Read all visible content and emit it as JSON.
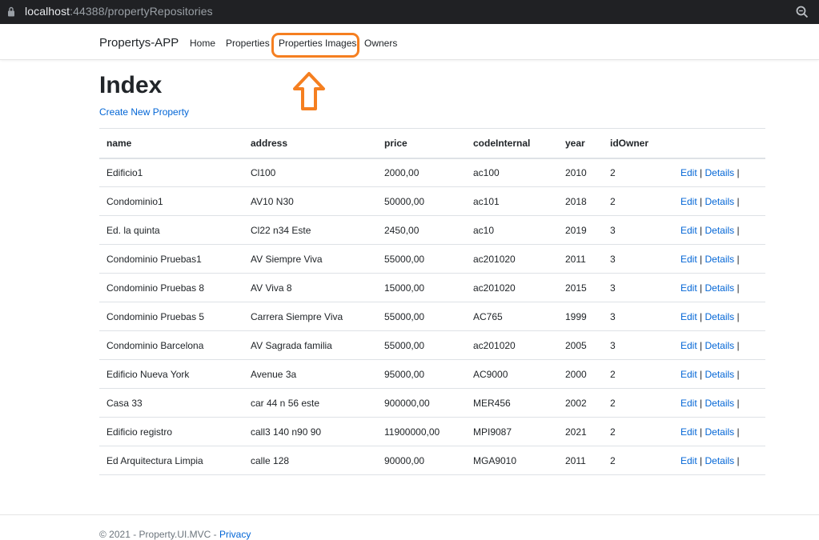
{
  "browser": {
    "url_host": "localhost",
    "url_rest": ":44388/propertyRepositories"
  },
  "nav": {
    "brand": "Propertys-APP",
    "items": [
      "Home",
      "Properties",
      "Properties Images",
      "Owners"
    ]
  },
  "page": {
    "title": "Index",
    "create_link": "Create New Property"
  },
  "table": {
    "columns": [
      "name",
      "address",
      "price",
      "codeInternal",
      "year",
      "idOwner"
    ],
    "rows": [
      [
        "Edificio1",
        "Cl100",
        "2000,00",
        "ac100",
        "2010",
        "2"
      ],
      [
        "Condominio1",
        "AV10 N30",
        "50000,00",
        "ac101",
        "2018",
        "2"
      ],
      [
        "Ed. la quinta",
        "Cl22 n34 Este",
        "2450,00",
        "ac10",
        "2019",
        "3"
      ],
      [
        "Condominio Pruebas1",
        "AV Siempre Viva",
        "55000,00",
        "ac201020",
        "2011",
        "3"
      ],
      [
        "Condominio Pruebas 8",
        "AV Viva 8",
        "15000,00",
        "ac201020",
        "2015",
        "3"
      ],
      [
        "Condominio Pruebas 5",
        "Carrera Siempre Viva",
        "55000,00",
        "AC765",
        "1999",
        "3"
      ],
      [
        "Condominio Barcelona",
        "AV Sagrada familia",
        "55000,00",
        "ac201020",
        "2005",
        "3"
      ],
      [
        "Edificio Nueva York",
        "Avenue 3a",
        "95000,00",
        "AC9000",
        "2000",
        "2"
      ],
      [
        "Casa 33",
        "car 44 n 56 este",
        "900000,00",
        "MER456",
        "2002",
        "2"
      ],
      [
        "Edificio registro",
        "call3 140 n90 90",
        "11900000,00",
        "MPI9087",
        "2021",
        "2"
      ],
      [
        "Ed Arquitectura Limpia",
        "calle 128",
        "90000,00",
        "MGA9010",
        "2011",
        "2"
      ]
    ],
    "edit_label": "Edit",
    "details_label": "Details",
    "separator": "|"
  },
  "footer": {
    "text": "© 2021 - Property.UI.MVC - ",
    "privacy_label": "Privacy"
  },
  "colors": {
    "annotation": "#f57f20",
    "link": "#0366d6",
    "urlbar_bg": "#202124"
  }
}
